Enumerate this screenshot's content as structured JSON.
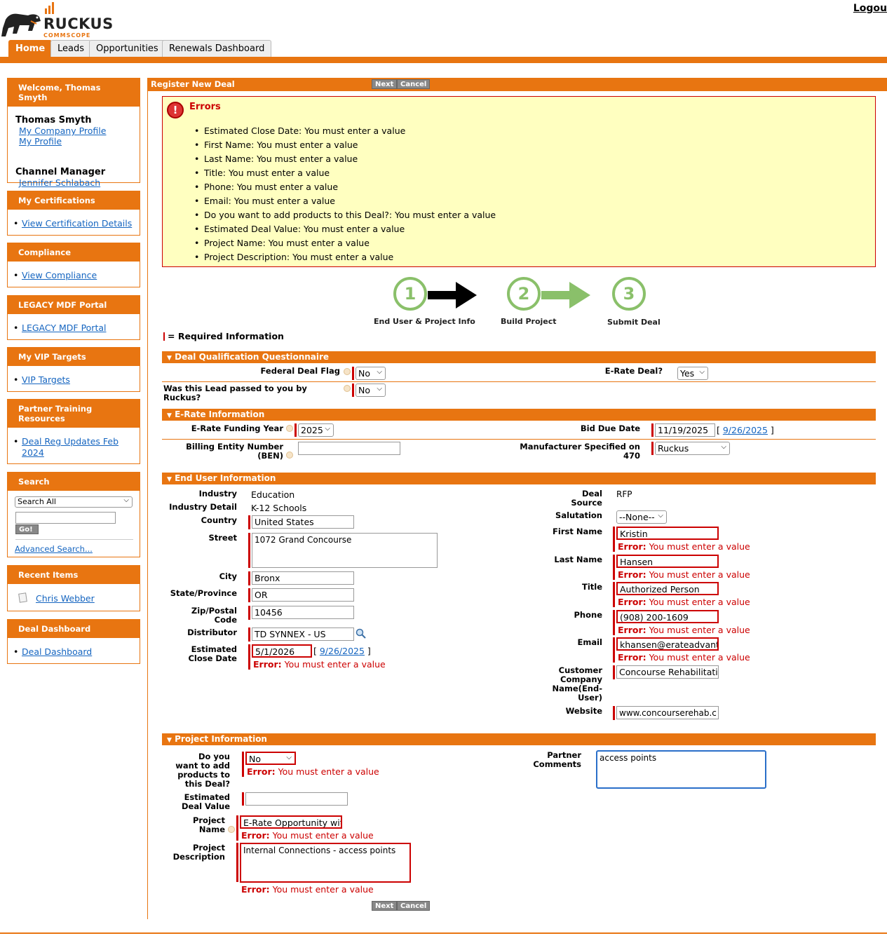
{
  "header": {
    "logo_text": "RUCKUS",
    "logo_sub": "COMMSCOPE",
    "logout": "Logou"
  },
  "tabs": [
    "Home",
    "Leads",
    "Opportunities",
    "Renewals Dashboard"
  ],
  "sidebar": {
    "welcome": "Welcome, Thomas Smyth",
    "user_name": "Thomas Smyth",
    "my_company_profile": "My Company Profile",
    "my_profile": "My Profile",
    "channel_manager_label": "Channel Manager",
    "channel_manager": "Jennifer Schlabach",
    "certs_title": "My Certifications",
    "certs_link": "View Certification Details",
    "compliance_title": "Compliance",
    "compliance_link": "View Compliance",
    "mdf_title": "LEGACY MDF Portal",
    "mdf_link": "LEGACY MDF Portal",
    "vip_title": "My VIP Targets",
    "vip_link": "VIP Targets",
    "training_title": "Partner Training Resources",
    "training_link": "Deal Reg Updates Feb 2024",
    "search_title": "Search",
    "search_scope": "Search All",
    "search_go": "Go!",
    "advanced_search": "Advanced Search...",
    "recent_title": "Recent Items",
    "recent_item": "Chris Webber",
    "dashboard_title": "Deal Dashboard",
    "dashboard_link": "Deal Dashboard"
  },
  "main": {
    "title": "Register New Deal",
    "next": "Next",
    "cancel": "Cancel",
    "errors_title": "Errors",
    "errors": [
      "Estimated Close Date: You must enter a value",
      "First Name: You must enter a value",
      "Last Name: You must enter a value",
      "Title: You must enter a value",
      "Phone: You must enter a value",
      "Email: You must enter a value",
      "Do you want to add products to this Deal?: You must enter a value",
      "Estimated Deal Value: You must enter a value",
      "Project Name: You must enter a value",
      "Project Description: You must enter a value"
    ],
    "steps": [
      "End User & Project Info",
      "Build Project",
      "Submit Deal"
    ],
    "step_numbers": [
      "1",
      "2",
      "3"
    ],
    "required_info": "= Required Information",
    "error_label": "Error:",
    "error_msg": "You must enter a value",
    "qual": {
      "title": "Deal Qualification Questionnaire",
      "federal_label": "Federal Deal Flag",
      "federal_val": "No",
      "erate_label": "E-Rate Deal?",
      "erate_val": "Yes",
      "passed_label": "Was this Lead passed to you by Ruckus?",
      "passed_val": "No"
    },
    "erate": {
      "title": "E-Rate Information",
      "funding_label": "E-Rate Funding Year",
      "funding_val": "2025",
      "bid_label": "Bid Due Date",
      "bid_val": "11/19/2025",
      "bid_link": "9/26/2025",
      "ben_label": "Billing Entity Number (BEN)",
      "ben_val": "",
      "mfr_label": "Manufacturer Specified on 470",
      "mfr_val": "Ruckus"
    },
    "enduser": {
      "title": "End User Information",
      "industry_label": "Industry",
      "industry_val": "Education",
      "detail_label": "Industry Detail",
      "detail_val": "K-12 Schools",
      "country_label": "Country",
      "country_val": "United States",
      "street_label": "Street",
      "street_val": "1072 Grand Concourse",
      "city_label": "City",
      "city_val": "Bronx",
      "state_label": "State/Province",
      "state_val": "OR",
      "zip_label": "Zip/Postal Code",
      "zip_val": "10456",
      "dist_label": "Distributor",
      "dist_val": "TD SYNNEX - US",
      "close_label": "Estimated Close Date",
      "close_val": "5/1/2026",
      "close_link": "9/26/2025",
      "source_label": "Deal Source",
      "source_val": "RFP",
      "salutation_label": "Salutation",
      "salutation_val": "--None--",
      "first_label": "First Name",
      "first_val": "Kristin",
      "last_label": "Last Name",
      "last_val": "Hansen",
      "title_label": "Title",
      "title_val": "Authorized Person",
      "phone_label": "Phone",
      "phone_val": "(908) 200-1609",
      "email_label": "Email",
      "email_val": "khansen@erateadvanta",
      "company_label": "Customer Company Name(End-User)",
      "company_val": "Concourse Rehabilitatic",
      "website_label": "Website",
      "website_val": "www.concourserehab.c"
    },
    "project": {
      "title": "Project Information",
      "add_label": "Do you want to add products to this Deal?",
      "add_val": "No",
      "value_label": "Estimated Deal Value",
      "value_val": "",
      "name_label": "Project Name",
      "name_val": "E-Rate Opportunity with",
      "desc_label": "Project Description",
      "desc_val": "Internal Connections - access points",
      "comments_label": "Partner Comments",
      "comments_val": "access points"
    }
  },
  "colors": {
    "brand": "#e87511",
    "error": "#cc0000",
    "step": "#8ac06a"
  }
}
